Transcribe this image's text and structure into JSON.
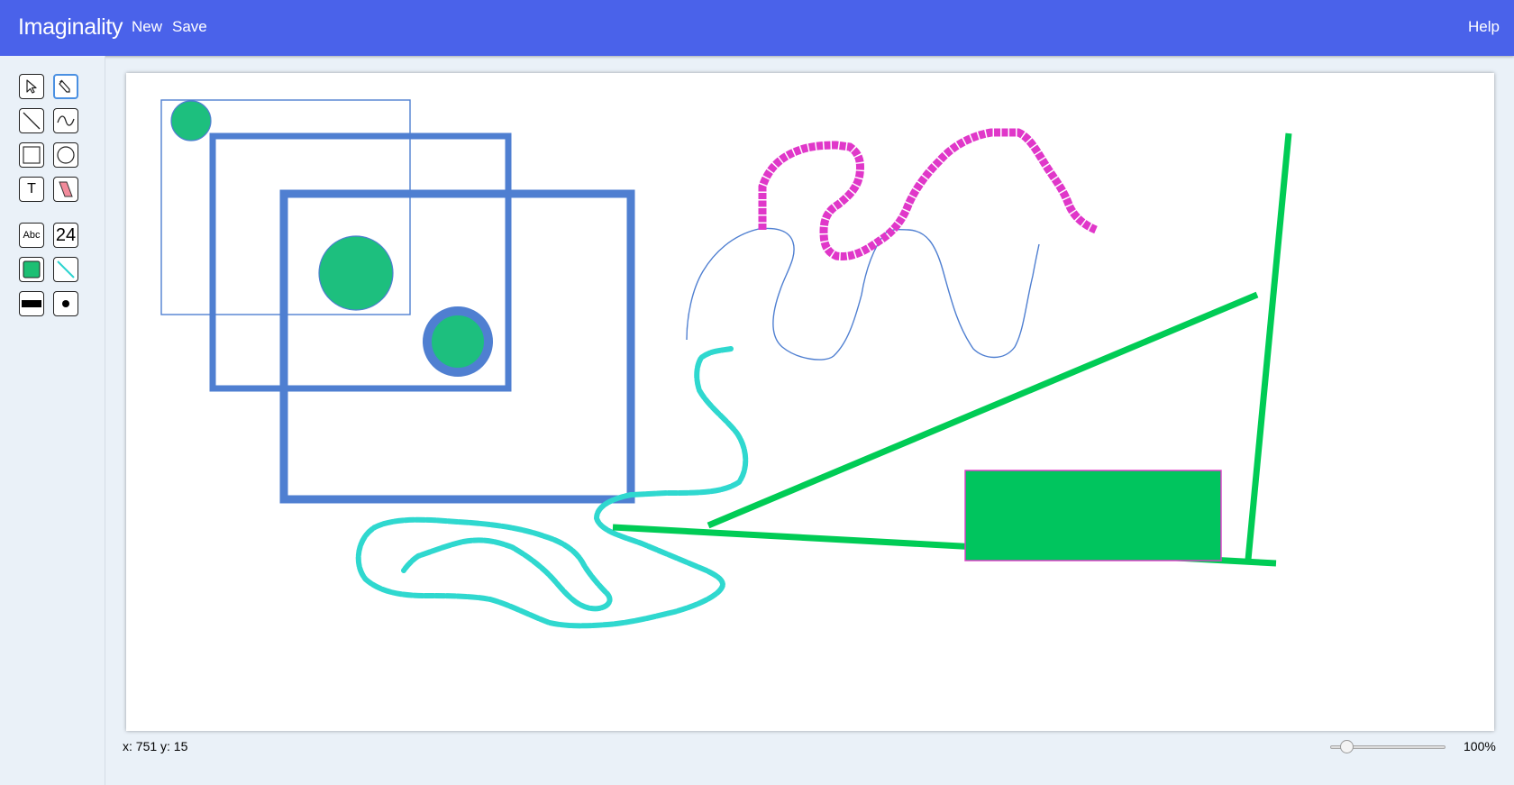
{
  "app": {
    "title": "Imaginality",
    "menu": {
      "new_label": "New",
      "save_label": "Save",
      "help_label": "Help"
    }
  },
  "toolbar": {
    "selected_tool": "pencil",
    "tools": [
      {
        "name": "select-tool",
        "icon": "cursor-arrow-icon"
      },
      {
        "name": "pencil-tool",
        "icon": "pencil-icon"
      },
      {
        "name": "line-tool",
        "icon": "diagonal-line-icon"
      },
      {
        "name": "curve-tool",
        "icon": "wave-icon"
      },
      {
        "name": "rectangle-tool",
        "icon": "square-icon"
      },
      {
        "name": "ellipse-tool",
        "icon": "circle-icon"
      },
      {
        "name": "text-tool",
        "icon": "text-icon"
      },
      {
        "name": "eraser-tool",
        "icon": "eraser-icon"
      }
    ],
    "text_tool_label": "T",
    "font_button_label": "Abc",
    "font_size_label": "24",
    "fill_color": "#1dbf73",
    "stroke_color": "#2dd4cf",
    "line_width_icon": "thick-line-icon",
    "point_size_icon": "dot-icon"
  },
  "status": {
    "coordinates": "x: 751  y: 15",
    "zoom_label": "100%",
    "zoom_level": 0.1
  },
  "colors": {
    "header": "#4a62ea",
    "shape_blue": "#4f7fd1",
    "shape_green_fill": "#1dbf7e",
    "magenta": "#e037c9",
    "cyan": "#2fd8cf",
    "line_green": "#00cc55",
    "rect_green": "#00c55e"
  }
}
